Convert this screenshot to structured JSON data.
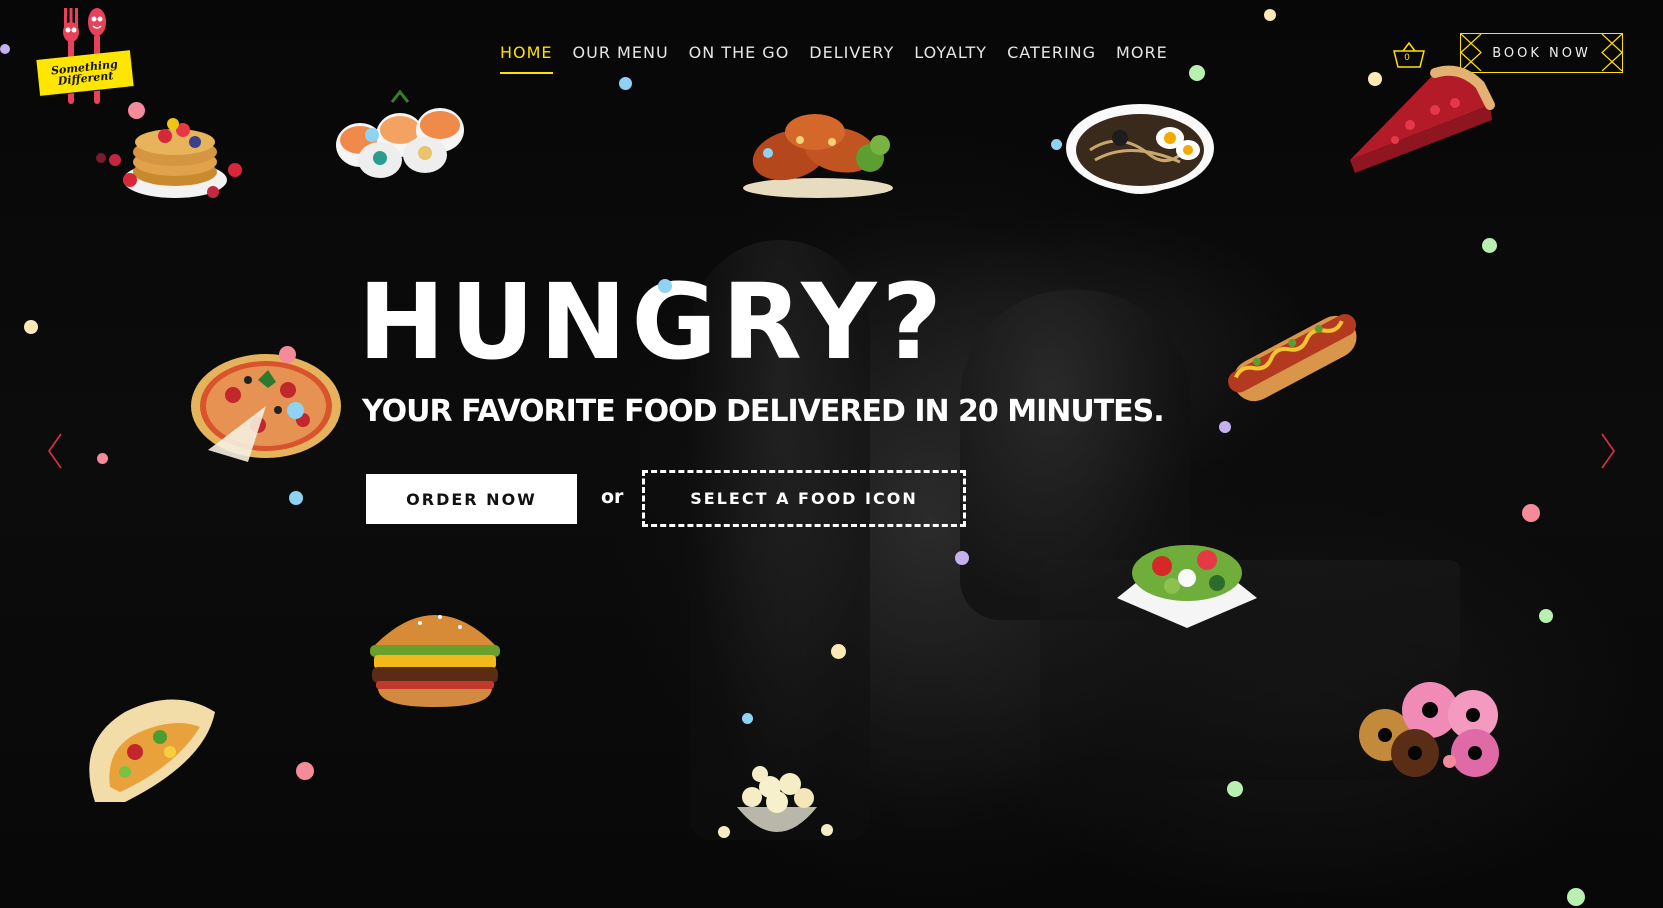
{
  "brand": {
    "logo_text": "Something\nDifferent",
    "colors": {
      "accent": "#ffe000",
      "background": "#050505",
      "text": "#ffffff"
    }
  },
  "nav": {
    "items": [
      {
        "label": "HOME",
        "active": true
      },
      {
        "label": "OUR MENU",
        "active": false
      },
      {
        "label": "ON THE GO",
        "active": false
      },
      {
        "label": "DELIVERY",
        "active": false
      },
      {
        "label": "LOYALTY",
        "active": false
      },
      {
        "label": "CATERING",
        "active": false
      },
      {
        "label": "MORE",
        "active": false
      }
    ]
  },
  "cart": {
    "icon": "basket-icon",
    "count": "0"
  },
  "book_button": {
    "label": "BOOK NOW"
  },
  "hero": {
    "title": "HUNGRY?",
    "subtitle": "YOUR FAVORITE FOOD DELIVERED IN 20 MINUTES.",
    "order_button": "ORDER NOW",
    "or_text": "or",
    "select_button": "SELECT A FOOD ICON"
  },
  "carousel": {
    "prev_icon": "chevron-left-icon",
    "next_icon": "chevron-right-icon"
  },
  "food_icons": [
    "pancakes-icon",
    "sushi-icon",
    "chicken-icon",
    "ramen-icon",
    "pie-icon",
    "pizza-icon",
    "hotdog-icon",
    "salad-icon",
    "burger-icon",
    "taco-icon",
    "popcorn-icon",
    "donuts-icon"
  ]
}
